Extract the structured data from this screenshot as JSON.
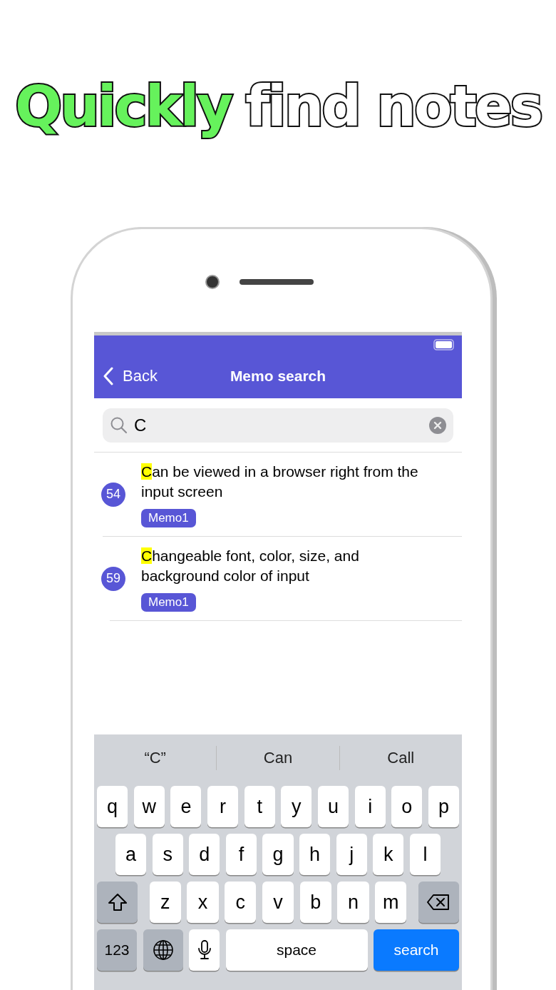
{
  "headline": [
    {
      "text": "Quickly",
      "color": "#66f25c"
    },
    {
      "text": "find notes",
      "color": "#ffffff"
    }
  ],
  "nav": {
    "back": "Back",
    "title": "Memo search"
  },
  "search": {
    "value": "C"
  },
  "results": [
    {
      "number": "54",
      "match": "C",
      "rest": "an be viewed in a browser right from the input screen",
      "tag": "Memo1"
    },
    {
      "number": "59",
      "match": "C",
      "rest": "hangeable font, color, size, and background color of input",
      "tag": "Memo1"
    }
  ],
  "keyboard": {
    "suggestions": [
      "“C”",
      "Can",
      "Call"
    ],
    "rows": [
      {
        "keys": [
          {
            "kind": "letter",
            "label": "q"
          },
          {
            "kind": "letter",
            "label": "w"
          },
          {
            "kind": "letter",
            "label": "e"
          },
          {
            "kind": "letter",
            "label": "r"
          },
          {
            "kind": "letter",
            "label": "t"
          },
          {
            "kind": "letter",
            "label": "y"
          },
          {
            "kind": "letter",
            "label": "u"
          },
          {
            "kind": "letter",
            "label": "i"
          },
          {
            "kind": "letter",
            "label": "o"
          },
          {
            "kind": "letter",
            "label": "p"
          }
        ]
      },
      {
        "keys": [
          {
            "kind": "letter",
            "label": "a"
          },
          {
            "kind": "letter",
            "label": "s"
          },
          {
            "kind": "letter",
            "label": "d"
          },
          {
            "kind": "letter",
            "label": "f"
          },
          {
            "kind": "letter",
            "label": "g"
          },
          {
            "kind": "letter",
            "label": "h"
          },
          {
            "kind": "letter",
            "label": "j"
          },
          {
            "kind": "letter",
            "label": "k"
          },
          {
            "kind": "letter",
            "label": "l"
          }
        ]
      },
      {
        "keys": [
          {
            "kind": "shift"
          },
          {
            "kind": "letter",
            "label": "z"
          },
          {
            "kind": "letter",
            "label": "x"
          },
          {
            "kind": "letter",
            "label": "c"
          },
          {
            "kind": "letter",
            "label": "v"
          },
          {
            "kind": "letter",
            "label": "b"
          },
          {
            "kind": "letter",
            "label": "n"
          },
          {
            "kind": "letter",
            "label": "m"
          },
          {
            "kind": "delete"
          }
        ]
      },
      {
        "keys": [
          {
            "kind": "numbers",
            "label": "123"
          },
          {
            "kind": "globe"
          },
          {
            "kind": "mic"
          },
          {
            "kind": "space",
            "label": "space"
          },
          {
            "kind": "action",
            "label": "search"
          }
        ]
      }
    ]
  }
}
